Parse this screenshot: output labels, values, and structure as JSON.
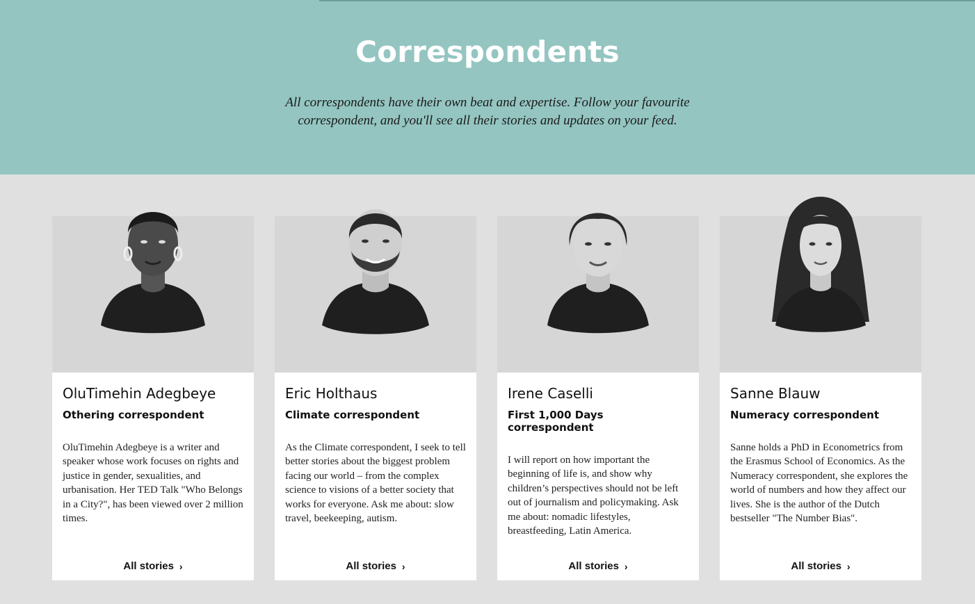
{
  "hero": {
    "title": "Correspondents",
    "intro": "All correspondents have their own beat and expertise. Follow your favourite correspondent, and you'll see all their stories and updates on your feed."
  },
  "cards": [
    {
      "name": "OluTimehin Adegbeye",
      "role": "Othering correspondent",
      "bio": "OluTimehin Adegbeye is a writer and speaker whose work focuses on rights and justice in gender, sexualities, and urbanisation. Her TED Talk \"Who Belongs in a City?\", has been viewed over 2 million times.",
      "link": "All stories",
      "icon": "chevron-right-icon"
    },
    {
      "name": "Eric Holthaus",
      "role": "Climate correspondent",
      "bio": "As the Climate correspondent, I seek to tell better stories about the biggest problem facing our world – from the complex science to visions of a better society that works for everyone. Ask me about: slow travel, beekeeping, autism.",
      "link": "All stories",
      "icon": "chevron-right-icon"
    },
    {
      "name": "Irene Caselli",
      "role": "First 1,000 Days correspondent",
      "bio": "I will report on how important the beginning of life is, and show why children’s perspectives should not be left out of journalism and policymaking. Ask me about: nomadic lifestyles, breastfeeding, Latin America.",
      "link": "All stories",
      "icon": "chevron-right-icon"
    },
    {
      "name": "Sanne Blauw",
      "role": "Numeracy correspondent",
      "bio": "Sanne holds a PhD in Econometrics from the Erasmus School of Economics. As the Numeracy correspondent, she explores the world of numbers and how they affect our lives. She is the author of the Dutch bestseller \"The Number Bias\".",
      "link": "All stories",
      "icon": "chevron-right-icon"
    }
  ],
  "colors": {
    "hero_bg": "#94c5c1",
    "page_bg": "#e0e0e0",
    "portrait_bg": "#d6d6d6"
  }
}
